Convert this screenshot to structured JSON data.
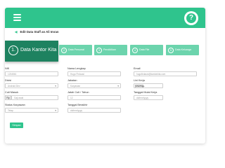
{
  "header": {
    "menu_icon": "hamburger-icon",
    "help_icon": "question-icon",
    "help_glyph": "?",
    "accent": "#2fc48d"
  },
  "page": {
    "back_glyph": "◀",
    "title": "Edit Data Staff an Ali Imran"
  },
  "steps": [
    {
      "number": "1.",
      "label": "Data Kantor Kita"
    },
    {
      "number": "2",
      "label": "Data Personal"
    },
    {
      "number": "3",
      "label": "Pendidikan"
    },
    {
      "number": "4",
      "label": "Data File"
    },
    {
      "number": "5",
      "label": "Data Keluarga"
    }
  ],
  "form": {
    "nik": {
      "label": "NIK",
      "placeholder": "1234561"
    },
    "nama_lengkap": {
      "label": "Nama Lengkap",
      "placeholder": "Hugo Firdausi"
    },
    "email": {
      "label": "Email",
      "placeholder": "hugofirdausi@kantorkita.com"
    },
    "divisi": {
      "label": "Divisi",
      "value": "Android Dev"
    },
    "jabatan": {
      "label": "Jabatan",
      "value": "Karyawan"
    },
    "lini_kerja": {
      "label": "Lini Kerja",
      "file_button": "Lihat Page"
    },
    "cuti_masuk": {
      "label": "Cuti Masuk",
      "prefix": "Rp",
      "placeholder": "Gaji awal"
    },
    "jatah_cuti": {
      "label": "Jatah Cuti / Tahun",
      "placeholder": "12"
    },
    "tanggal_mulai_kerja": {
      "label": "Tanggal Mulai Kerja",
      "placeholder": "dd/mm/yyyy"
    },
    "status_karyawan": {
      "label": "Status Karyawan",
      "value": "Tetap"
    },
    "tanggal_berakhir": {
      "label": "Tanggal Berakhir",
      "placeholder": "dd/mm/yyyy"
    },
    "submit_label": "Simpan"
  }
}
